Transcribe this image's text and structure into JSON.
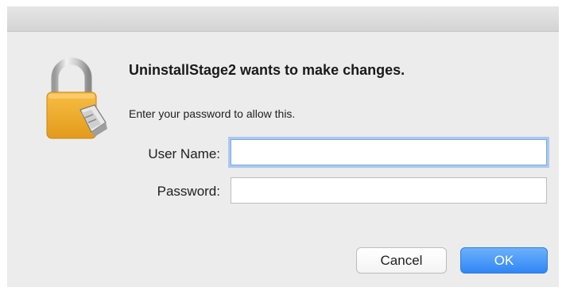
{
  "dialog": {
    "title": "UninstallStage2 wants to make changes.",
    "message": "Enter your password to allow this.",
    "icon": "lock-icon"
  },
  "form": {
    "username_label": "User Name:",
    "username_value": "",
    "password_label": "Password:",
    "password_value": ""
  },
  "buttons": {
    "cancel_label": "Cancel",
    "ok_label": "OK"
  },
  "colors": {
    "accent": "#3a8ef7",
    "background": "#ececec",
    "lock_gold": "#f0a826"
  }
}
